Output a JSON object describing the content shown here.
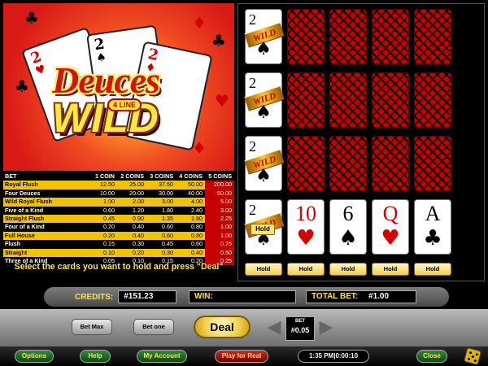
{
  "logo": {
    "title_line1": "Deuces",
    "title_line2": "WILD",
    "badge": "4 LINE"
  },
  "paytable": {
    "headers": [
      "BET",
      "1 COIN",
      "2 COINS",
      "3 COINS",
      "4 COINS",
      "5 COINS"
    ],
    "rows": [
      [
        "Royal Flush",
        "12.50",
        "25.00",
        "37.50",
        "50.00",
        "200.00"
      ],
      [
        "Four Deuces",
        "10.00",
        "20.00",
        "30.00",
        "40.00",
        "50.00"
      ],
      [
        "Wild Royal Flush",
        "1.00",
        "2.00",
        "3.00",
        "4.00",
        "5.00"
      ],
      [
        "Five of a Kind",
        "0.60",
        "1.20",
        "1.80",
        "2.40",
        "3.00"
      ],
      [
        "Straight Flush",
        "0.45",
        "0.90",
        "1.35",
        "1.80",
        "2.25"
      ],
      [
        "Four of a Kind",
        "0.20",
        "0.40",
        "0.60",
        "0.80",
        "1.00"
      ],
      [
        "Full House",
        "0.20",
        "0.40",
        "0.60",
        "0.80",
        "1.00"
      ],
      [
        "Flush",
        "0.15",
        "0.30",
        "0.45",
        "0.60",
        "0.75"
      ],
      [
        "Straight",
        "0.10",
        "0.20",
        "0.30",
        "0.40",
        "0.50"
      ],
      [
        "Three of a Kind",
        "0.05",
        "0.10",
        "0.15",
        "0.20",
        "0.25"
      ]
    ]
  },
  "instruction": "Select the cards you want to hold and press \"Deal\"",
  "cards": {
    "wild_label": "WILD",
    "hold_tag": "Hold",
    "held_rows": [
      {
        "rank": "2",
        "suit": "♠"
      },
      {
        "rank": "2",
        "suit": "♠"
      },
      {
        "rank": "2",
        "suit": "♠"
      }
    ],
    "main_hand": [
      {
        "rank": "2",
        "suit": "♠",
        "color": "#000000"
      },
      {
        "rank": "10",
        "suit": "♥",
        "color": "#d30000"
      },
      {
        "rank": "6",
        "suit": "♠",
        "color": "#000000"
      },
      {
        "rank": "Q",
        "suit": "♥",
        "color": "#d30000"
      },
      {
        "rank": "A",
        "suit": "♣",
        "color": "#000000"
      }
    ],
    "hold_buttons": [
      "Hold",
      "Hold",
      "Hold",
      "Hold",
      "Hold"
    ]
  },
  "status": {
    "credits_label": "CREDITS:",
    "credits_value": "#151.23",
    "win_label": "WIN:",
    "win_value": "",
    "total_bet_label": "TOTAL BET:",
    "total_bet_value": "#1.00"
  },
  "controls": {
    "bet_max": "Bet Max",
    "bet_one": "Bet one",
    "deal": "Deal",
    "bet_label": "BET",
    "bet_value": "#0.05"
  },
  "footer": {
    "options": "Options",
    "help": "Help",
    "my_account": "My Account",
    "play_for_real": "Play for Real",
    "clock": "1:35 PM|0:00:10",
    "close": "Close"
  },
  "colors": {
    "accent_yellow": "#ffe24a",
    "table_yellow": "#f2c400",
    "card_back_red": "#c40000",
    "button_green": "#0d4a15"
  }
}
